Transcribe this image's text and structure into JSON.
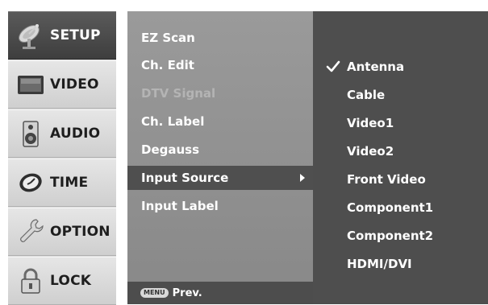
{
  "sidebar": {
    "items": [
      {
        "label": "SETUP",
        "icon": "satellite-dish-icon",
        "active": true
      },
      {
        "label": "VIDEO",
        "icon": "monitor-icon",
        "active": false
      },
      {
        "label": "AUDIO",
        "icon": "speaker-icon",
        "active": false
      },
      {
        "label": "TIME",
        "icon": "clock-icon",
        "active": false
      },
      {
        "label": "OPTION",
        "icon": "wrench-icon",
        "active": false
      },
      {
        "label": "LOCK",
        "icon": "padlock-icon",
        "active": false
      }
    ]
  },
  "menu": {
    "items": [
      {
        "label": "EZ Scan",
        "enabled": true
      },
      {
        "label": "Ch. Edit",
        "enabled": true
      },
      {
        "label": "DTV Signal",
        "enabled": false
      },
      {
        "label": "Ch. Label",
        "enabled": true
      },
      {
        "label": "Degauss",
        "enabled": true
      },
      {
        "label": "Input Source",
        "enabled": true,
        "selected": true,
        "submenu_arrow": true
      },
      {
        "label": "Input Label",
        "enabled": true
      }
    ],
    "footer": {
      "button_badge": "MENU",
      "label": "Prev."
    }
  },
  "options": {
    "items": [
      {
        "label": "Antenna",
        "checked": true
      },
      {
        "label": "Cable",
        "checked": false
      },
      {
        "label": "Video1",
        "checked": false
      },
      {
        "label": "Video2",
        "checked": false
      },
      {
        "label": "Front Video",
        "checked": false
      },
      {
        "label": "Component1",
        "checked": false
      },
      {
        "label": "Component2",
        "checked": false
      },
      {
        "label": "HDMI/DVI",
        "checked": false
      }
    ]
  },
  "colors": {
    "sidebar_bg": "#dedede",
    "sidebar_active": "#4a4a4a",
    "menu_bg": "#919191",
    "menu_selected": "#4f4f4f",
    "options_bg": "#4e4e4e",
    "text_light": "#ffffff",
    "text_disabled": "#b4b4b4"
  }
}
